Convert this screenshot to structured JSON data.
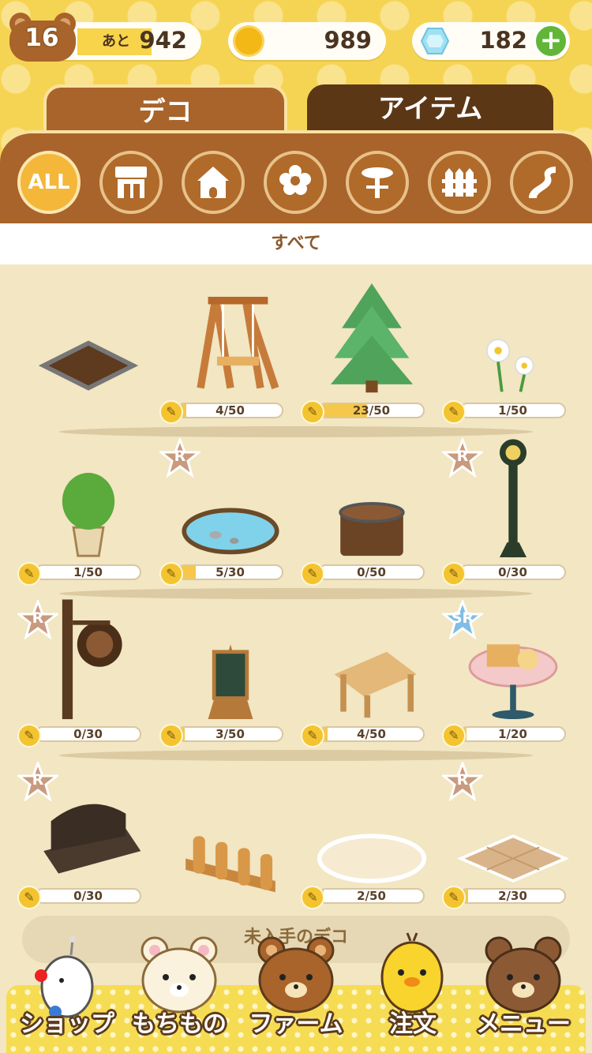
{
  "status": {
    "level": "16",
    "remaining_label": "あと",
    "remaining_xp": "942",
    "coins": "989",
    "gems": "182",
    "plus_label": "+"
  },
  "tabs": [
    {
      "label": "デコ",
      "active": true
    },
    {
      "label": "アイテム",
      "active": false
    }
  ],
  "categories": [
    {
      "icon": "all-icon",
      "label": "ALL",
      "active": true
    },
    {
      "icon": "shop-icon",
      "active": false
    },
    {
      "icon": "house-icon",
      "active": false
    },
    {
      "icon": "flower-icon",
      "active": false
    },
    {
      "icon": "table-icon",
      "active": false
    },
    {
      "icon": "fence-icon",
      "active": false
    },
    {
      "icon": "path-icon",
      "active": false
    }
  ],
  "section_title": "すべて",
  "items": [
    {
      "name": "soil-patch",
      "count": "",
      "rarity": ""
    },
    {
      "name": "wooden-swing",
      "count": "4/50",
      "progress": 0.08,
      "rarity": ""
    },
    {
      "name": "fir-tree",
      "count": "23/50",
      "progress": 0.46,
      "rarity": ""
    },
    {
      "name": "white-flowers",
      "count": "1/50",
      "progress": 0.02,
      "rarity": ""
    },
    {
      "name": "potted-plant",
      "count": "1/50",
      "progress": 0.02,
      "rarity": ""
    },
    {
      "name": "small-pond",
      "count": "5/30",
      "progress": 0.17,
      "rarity": "R"
    },
    {
      "name": "tree-stump",
      "count": "0/50",
      "progress": 0,
      "rarity": ""
    },
    {
      "name": "street-lamp",
      "count": "0/30",
      "progress": 0,
      "rarity": "R"
    },
    {
      "name": "cafe-sign-post",
      "count": "0/30",
      "progress": 0,
      "rarity": "R"
    },
    {
      "name": "menu-board",
      "count": "3/50",
      "progress": 0.06,
      "rarity": ""
    },
    {
      "name": "wooden-table",
      "count": "4/50",
      "progress": 0.08,
      "rarity": ""
    },
    {
      "name": "picnic-table",
      "count": "1/20",
      "progress": 0.05,
      "rarity": "SR"
    },
    {
      "name": "iron-bench",
      "count": "0/30",
      "progress": 0,
      "rarity": "R"
    },
    {
      "name": "wooden-fence",
      "count": "",
      "rarity": ""
    },
    {
      "name": "cream-rug",
      "count": "2/50",
      "progress": 0.04,
      "rarity": ""
    },
    {
      "name": "tile-floor",
      "count": "2/30",
      "progress": 0.07,
      "rarity": "R"
    }
  ],
  "undiscovered_label": "未入手のデコ",
  "nav": [
    {
      "icon": "bird-icon",
      "label": "ショップ"
    },
    {
      "icon": "korilakkuma-icon",
      "label": "もちもの"
    },
    {
      "icon": "rilakkuma-icon",
      "label": "ファーム"
    },
    {
      "icon": "kiiroitori-icon",
      "label": "注文"
    },
    {
      "icon": "chairoikoguma-icon",
      "label": "メニュー"
    }
  ],
  "colors": {
    "header_yellow": "#f6d453",
    "tab_brown": "#a8642a",
    "tab_dark": "#5c3716",
    "background": "#f2e6c3",
    "text_brown": "#4a3420"
  }
}
